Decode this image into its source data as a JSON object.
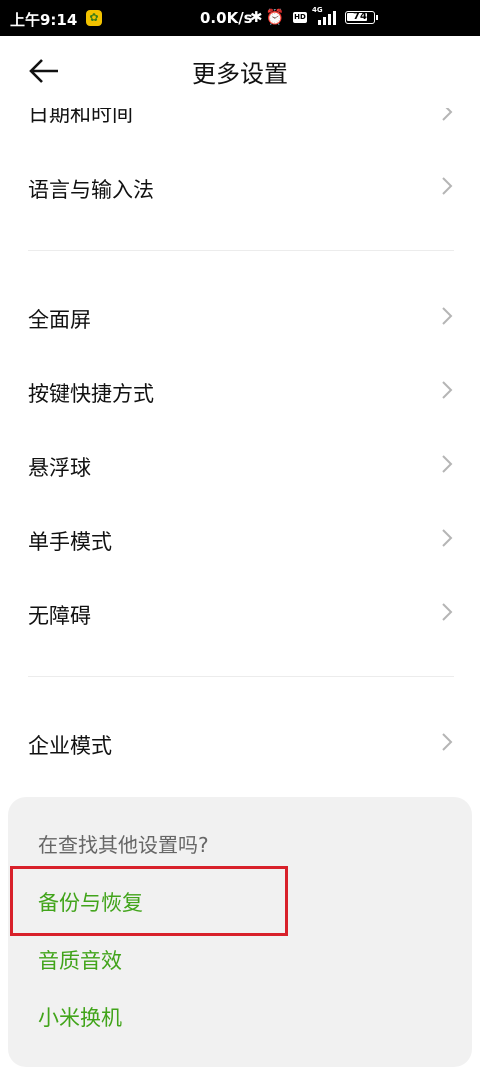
{
  "status_bar": {
    "time": "上午9:14",
    "speed": "0.0K/s",
    "network": "4G",
    "battery": "74"
  },
  "header": {
    "title": "更多设置"
  },
  "settings": {
    "clipped_item": "日期和时间",
    "group1": [
      "语言与输入法"
    ],
    "group2": [
      "全面屏",
      "按键快捷方式",
      "悬浮球",
      "单手模式",
      "无障碍"
    ],
    "group3": [
      "企业模式"
    ]
  },
  "suggestions": {
    "question": "在查找其他设置吗?",
    "links": [
      "备份与恢复",
      "音质音效",
      "小米换机"
    ]
  }
}
